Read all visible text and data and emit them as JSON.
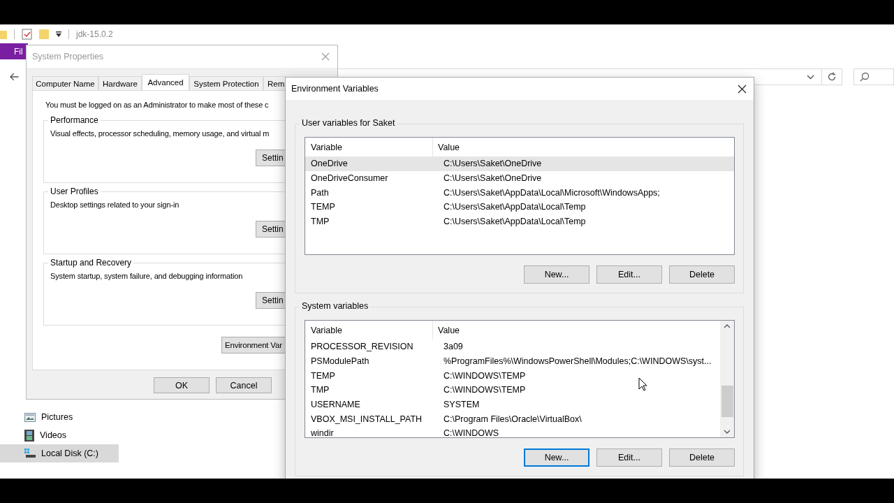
{
  "explorer": {
    "quick_access_title": "jdk-15.0.2",
    "ribbon_tab": "Fil",
    "sidebar": [
      {
        "label": "Pictures",
        "kind": "pictures",
        "selected": false
      },
      {
        "label": "Videos",
        "kind": "videos",
        "selected": false
      },
      {
        "label": "Local Disk (C:)",
        "kind": "disk",
        "selected": true
      }
    ]
  },
  "system_properties": {
    "title": "System Properties",
    "tabs": [
      {
        "label": "Computer Name",
        "selected": false
      },
      {
        "label": "Hardware",
        "selected": false
      },
      {
        "label": "Advanced",
        "selected": true
      },
      {
        "label": "System Protection",
        "selected": false
      },
      {
        "label": "Rem",
        "selected": false
      }
    ],
    "notice": "You must be logged on as an Administrator to make most of these c",
    "groups": [
      {
        "title": "Performance",
        "description": "Visual effects, processor scheduling, memory usage, and virtual m",
        "button": "Settin"
      },
      {
        "title": "User Profiles",
        "description": "Desktop settings related to your sign-in",
        "button": "Settin"
      },
      {
        "title": "Startup and Recovery",
        "description": "System startup, system failure, and debugging information",
        "button": "Settin"
      }
    ],
    "env_button": "Environment Var",
    "buttons": [
      "OK",
      "Cancel"
    ]
  },
  "environment_variables": {
    "title": "Environment Variables",
    "sections": [
      {
        "title": "User variables for Saket",
        "columns": [
          "Variable",
          "Value"
        ],
        "scrollable": false,
        "rows": [
          {
            "variable": "OneDrive",
            "value": "C:\\Users\\Saket\\OneDrive",
            "selected": true
          },
          {
            "variable": "OneDriveConsumer",
            "value": "C:\\Users\\Saket\\OneDrive",
            "selected": false
          },
          {
            "variable": "Path",
            "value": "C:\\Users\\Saket\\AppData\\Local\\Microsoft\\WindowsApps;",
            "selected": false
          },
          {
            "variable": "TEMP",
            "value": "C:\\Users\\Saket\\AppData\\Local\\Temp",
            "selected": false
          },
          {
            "variable": "TMP",
            "value": "C:\\Users\\Saket\\AppData\\Local\\Temp",
            "selected": false
          }
        ],
        "buttons": [
          {
            "label": "New...",
            "focused": false
          },
          {
            "label": "Edit...",
            "focused": false
          },
          {
            "label": "Delete",
            "focused": false
          }
        ]
      },
      {
        "title": "System variables",
        "columns": [
          "Variable",
          "Value"
        ],
        "scrollable": true,
        "rows": [
          {
            "variable": "PROCESSOR_REVISION",
            "value": "3a09",
            "selected": false
          },
          {
            "variable": "PSModulePath",
            "value": "%ProgramFiles%\\WindowsPowerShell\\Modules;C:\\WINDOWS\\syst...",
            "selected": false
          },
          {
            "variable": "TEMP",
            "value": "C:\\WINDOWS\\TEMP",
            "selected": false
          },
          {
            "variable": "TMP",
            "value": "C:\\WINDOWS\\TEMP",
            "selected": false
          },
          {
            "variable": "USERNAME",
            "value": "SYSTEM",
            "selected": false
          },
          {
            "variable": "VBOX_MSI_INSTALL_PATH",
            "value": "C:\\Program Files\\Oracle\\VirtualBox\\",
            "selected": false
          },
          {
            "variable": "windir",
            "value": "C:\\WINDOWS",
            "selected": false
          }
        ],
        "buttons": [
          {
            "label": "New...",
            "focused": true
          },
          {
            "label": "Edit...",
            "focused": false
          },
          {
            "label": "Delete",
            "focused": false
          }
        ]
      }
    ]
  }
}
